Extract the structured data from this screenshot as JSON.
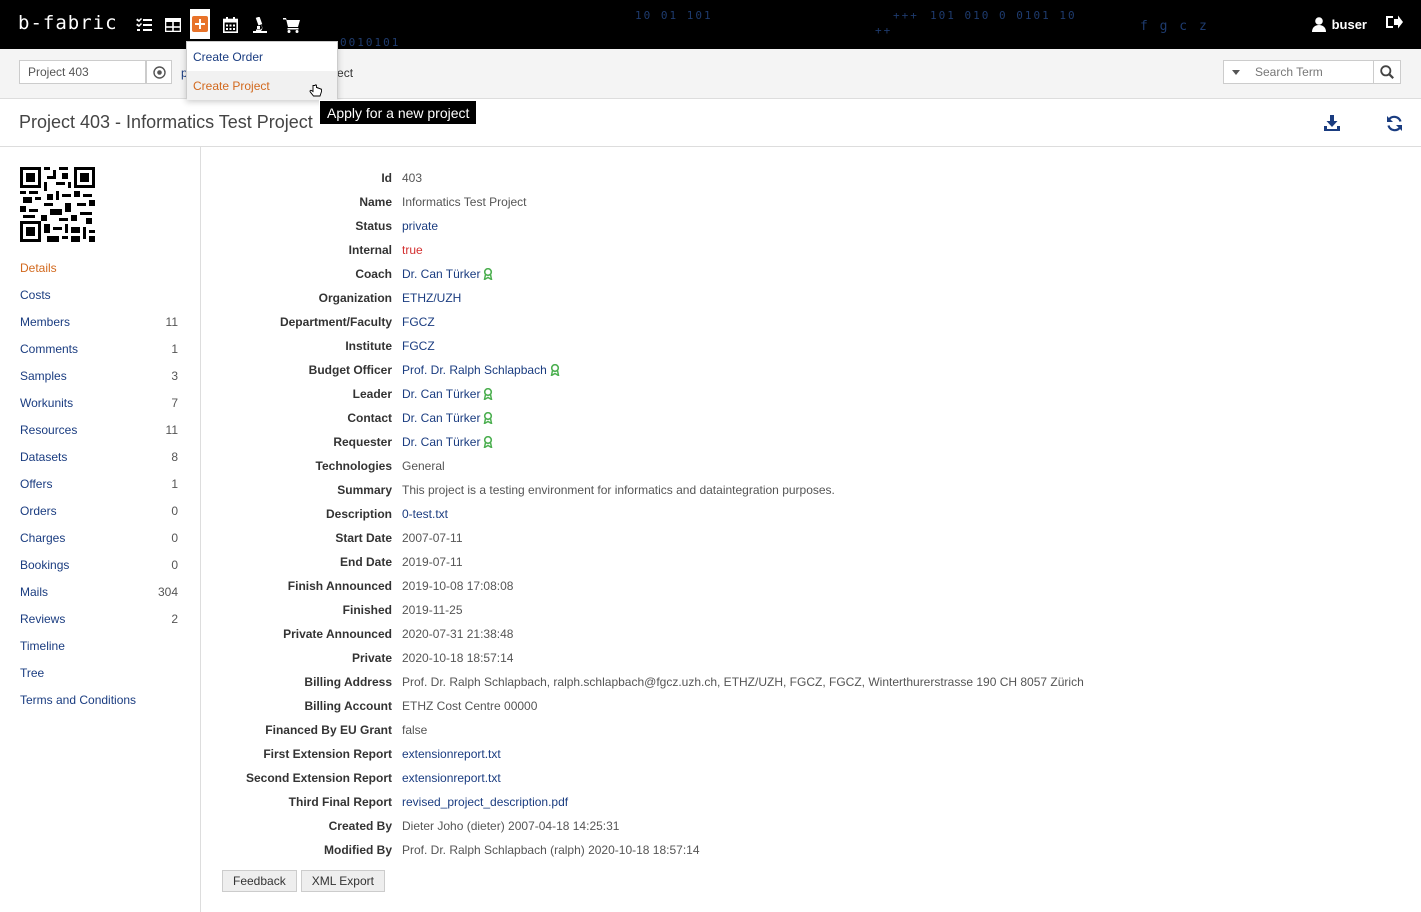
{
  "navbar": {
    "brand": "b-fabric",
    "deco_text": [
      "10  01  101",
      "101  010 0  0101 10",
      "0010101",
      "f g c z",
      "+++",
      "++"
    ],
    "user": "buser"
  },
  "subbar": {
    "project_value": "Project 403",
    "breadcrumb_prefix": "p",
    "breadcrumb_suffix": "oject",
    "search_placeholder": "Search Term"
  },
  "title": "Project 403 - Informatics Test Project",
  "dropdown": {
    "items": [
      {
        "label": "Create Order"
      },
      {
        "label": "Create Project"
      }
    ],
    "tooltip": "Apply for a new project"
  },
  "sidebar": {
    "items": [
      {
        "label": "Details",
        "count": ""
      },
      {
        "label": "Costs",
        "count": ""
      },
      {
        "label": "Members",
        "count": "11"
      },
      {
        "label": "Comments",
        "count": "1"
      },
      {
        "label": "Samples",
        "count": "3"
      },
      {
        "label": "Workunits",
        "count": "7"
      },
      {
        "label": "Resources",
        "count": "11"
      },
      {
        "label": "Datasets",
        "count": "8"
      },
      {
        "label": "Offers",
        "count": "1"
      },
      {
        "label": "Orders",
        "count": "0"
      },
      {
        "label": "Charges",
        "count": "0"
      },
      {
        "label": "Bookings",
        "count": "0"
      },
      {
        "label": "Mails",
        "count": "304"
      },
      {
        "label": "Reviews",
        "count": "2"
      },
      {
        "label": "Timeline",
        "count": ""
      },
      {
        "label": "Tree",
        "count": ""
      },
      {
        "label": "Terms and Conditions",
        "count": ""
      }
    ]
  },
  "details": [
    {
      "label": "Id",
      "value": "403"
    },
    {
      "label": "Name",
      "value": "Informatics Test Project"
    },
    {
      "label": "Status",
      "value": "private"
    },
    {
      "label": "Internal",
      "value": "true"
    },
    {
      "label": "Coach",
      "value": "Dr. Can Türker"
    },
    {
      "label": "Organization",
      "value": "ETHZ/UZH"
    },
    {
      "label": "Department/Faculty",
      "value": "FGCZ"
    },
    {
      "label": "Institute",
      "value": "FGCZ"
    },
    {
      "label": "Budget Officer",
      "value": "Prof. Dr. Ralph Schlapbach"
    },
    {
      "label": "Leader",
      "value": "Dr. Can Türker"
    },
    {
      "label": "Contact",
      "value": "Dr. Can Türker"
    },
    {
      "label": "Requester",
      "value": "Dr. Can Türker"
    },
    {
      "label": "Technologies",
      "value": "General"
    },
    {
      "label": "Summary",
      "value": "This project is a testing environment for informatics and dataintegration purposes."
    },
    {
      "label": "Description",
      "value": "0-test.txt"
    },
    {
      "label": "Start Date",
      "value": "2007-07-11"
    },
    {
      "label": "End Date",
      "value": "2019-07-11"
    },
    {
      "label": "Finish Announced",
      "value": "2019-10-08 17:08:08"
    },
    {
      "label": "Finished",
      "value": "2019-11-25"
    },
    {
      "label": "Private Announced",
      "value": "2020-07-31 21:38:48"
    },
    {
      "label": "Private",
      "value": "2020-10-18 18:57:14"
    },
    {
      "label": "Billing Address",
      "value": "Prof. Dr. Ralph Schlapbach, ralph.schlapbach@fgcz.uzh.ch, ETHZ/UZH, FGCZ, FGCZ, Winterthurerstrasse 190 CH 8057 Zürich"
    },
    {
      "label": "Billing Account",
      "value": "ETHZ Cost Centre 00000"
    },
    {
      "label": "Financed By EU Grant",
      "value": "false"
    },
    {
      "label": "First Extension Report",
      "value": "extensionreport.txt"
    },
    {
      "label": "Second Extension Report",
      "value": "extensionreport.txt"
    },
    {
      "label": "Third Final Report",
      "value": "revised_project_description.pdf"
    },
    {
      "label": "Created By",
      "value": "Dieter Joho (dieter) 2007-04-18 14:25:31"
    },
    {
      "label": "Modified By",
      "value": "Prof. Dr. Ralph Schlapbach (ralph) 2020-10-18 18:57:14"
    }
  ],
  "buttons": {
    "feedback": "Feedback",
    "xml_export": "XML Export"
  },
  "colors": {
    "accent": "#d2691e",
    "link": "#1a3c80",
    "award": "#4caf50",
    "navbar": "#000000"
  }
}
